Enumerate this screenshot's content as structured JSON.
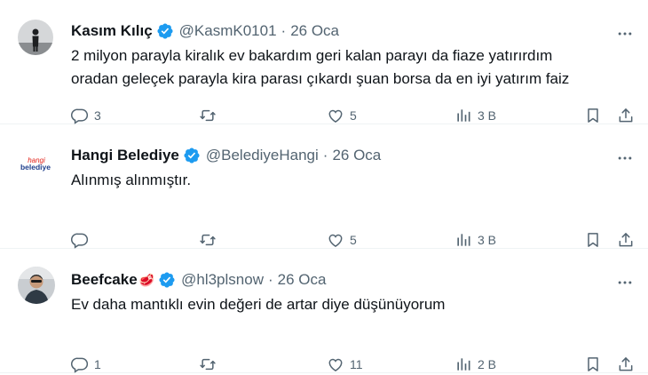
{
  "tweets": [
    {
      "name": "Kasım Kılıç",
      "handle": "@KasmK0101",
      "date": "26 Oca",
      "name_emoji": "",
      "text_lines": [
        "2 milyon parayla kiralık ev bakardım geri kalan parayı da fiaze yatırırdım",
        "oradan geleçek parayla kira parası çıkardı şuan borsa da en iyi yatırım faiz"
      ],
      "replies": "3",
      "reposts": "",
      "likes": "5",
      "views": "3 B",
      "avatar": "dark-figure-avatar"
    },
    {
      "name": "Hangi Belediye",
      "handle": "@BelediyeHangi",
      "date": "26 Oca",
      "name_emoji": "",
      "text_lines": [
        "Alınmış alınmıştır."
      ],
      "replies": "",
      "reposts": "",
      "likes": "5",
      "views": "3 B",
      "avatar": "hangi-belediye-logo",
      "logo_text_top": "hangi",
      "logo_text_bottom": "belediye"
    },
    {
      "name": "Beefcake",
      "handle": "@hl3plsnow",
      "date": "26 Oca",
      "name_emoji": "🥩",
      "text_lines": [
        "Ev daha mantıklı evin değeri de artar diye düşünüyorum"
      ],
      "replies": "1",
      "reposts": "",
      "likes": "11",
      "views": "2 B",
      "avatar": "person-photo-avatar"
    }
  ],
  "icons": {
    "verified": "verified-badge-icon",
    "more": "more-icon",
    "reply": "reply-icon",
    "repost": "repost-icon",
    "like": "like-icon",
    "views": "views-icon",
    "bookmark": "bookmark-icon",
    "share": "share-icon"
  },
  "colors": {
    "verified": "#1d9bf0",
    "muted": "#536471",
    "text": "#0f1419"
  }
}
